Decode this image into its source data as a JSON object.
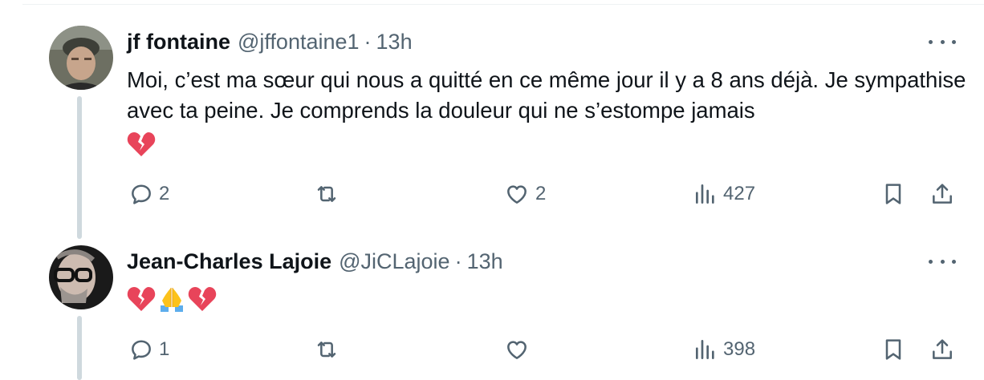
{
  "tweets": [
    {
      "author_name": "jf fontaine",
      "handle": "@jffontaine1",
      "separator": "·",
      "time": "13h",
      "text": "Moi, c’est ma sœur qui nous a quitté en ce même jour il y a 8 ans déjà. Je sympathise avec ta peine. Je comprends la douleur qui ne s’estompe jamais",
      "emojis": [
        "broken-heart"
      ],
      "replies": "2",
      "retweets": "",
      "likes": "2",
      "views": "427"
    },
    {
      "author_name": "Jean-Charles Lajoie",
      "handle": "@JiCLajoie",
      "separator": "·",
      "time": "13h",
      "text": "",
      "emojis": [
        "broken-heart",
        "folded-hands",
        "broken-heart"
      ],
      "replies": "1",
      "retweets": "",
      "likes": "",
      "views": "398"
    }
  ],
  "icons": {
    "reply": "reply-icon",
    "retweet": "retweet-icon",
    "like": "heart-icon",
    "views": "views-icon",
    "bookmark": "bookmark-icon",
    "share": "share-icon",
    "more": "more-icon"
  },
  "colors": {
    "text_primary": "#0f1419",
    "text_secondary": "#536471",
    "thread_line": "#cfd9de",
    "broken_heart": "#e8445a"
  }
}
